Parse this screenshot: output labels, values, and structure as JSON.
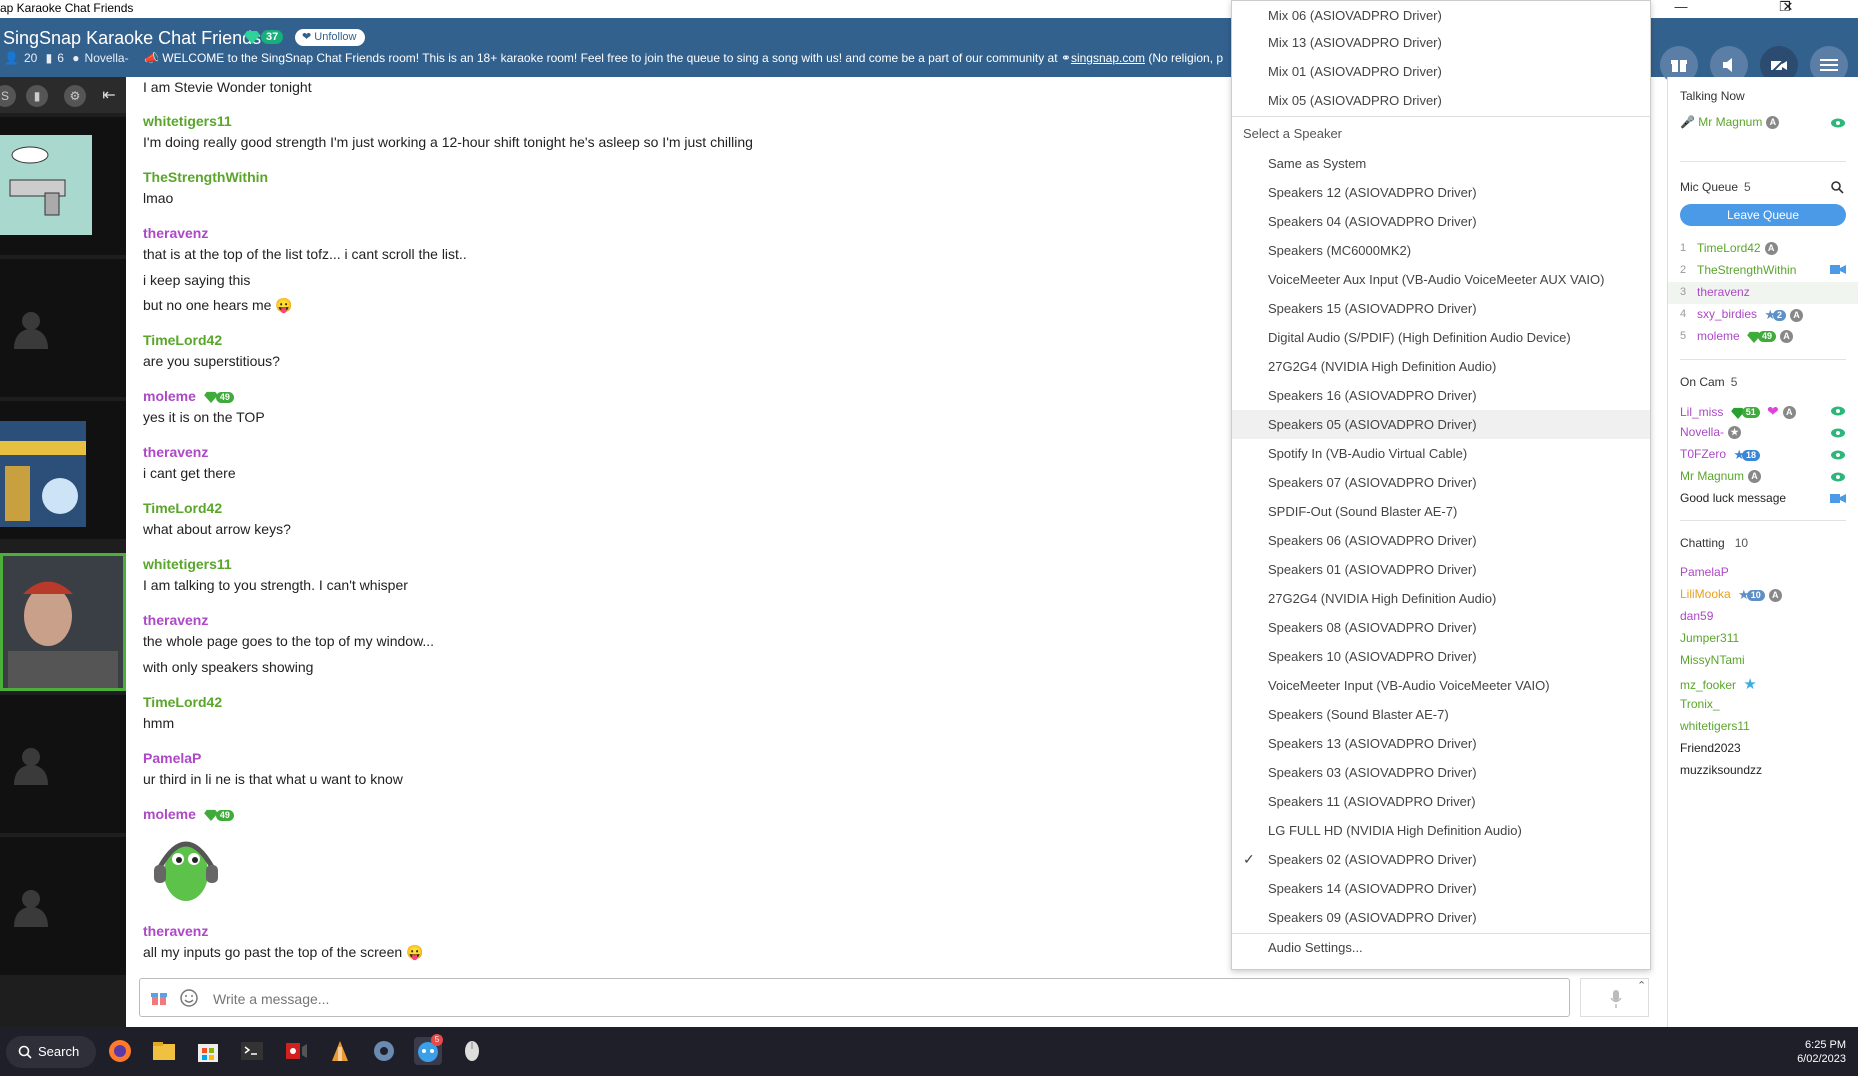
{
  "window": {
    "title": "ap Karaoke Chat Friends"
  },
  "header": {
    "room_title": "SingSnap Karaoke Chat Friends",
    "gem_count": "37",
    "unfollow_label": "Unfollow",
    "stats": {
      "users": "20",
      "cams": "6",
      "host": "Novella-"
    },
    "welcome": "WELCOME to the SingSnap Chat Friends room! This is an 18+ karaoke room! Feel free to join the queue to sing a song with us! and come be a part of our community at",
    "welcome_link": "singsnap.com",
    "welcome_tail": "(No religion, p"
  },
  "chat": {
    "messages": [
      {
        "text": "I am Stevie Wonder tonight"
      },
      {
        "user": "whitetigers11",
        "text": "I'm doing really good strength I'm just working a 12-hour shift tonight he's asleep so I'm just chilling"
      },
      {
        "user": "TheStrengthWithin",
        "text": "lmao"
      },
      {
        "user": "theravenz",
        "lines": [
          "that is at the top of the list tofz... i cant scroll the list..",
          "i keep saying this",
          "but no one hears me 😛"
        ]
      },
      {
        "user": "TimeLord42",
        "text": "are you superstitious?"
      },
      {
        "user": "moleme",
        "gem": "49",
        "text": "yes it is on the TOP"
      },
      {
        "user": "theravenz",
        "text": "i cant get there"
      },
      {
        "user": "TimeLord42",
        "text": "what about arrow keys?"
      },
      {
        "user": "whitetigers11",
        "text": "I am talking to you strength. I can't whisper"
      },
      {
        "user": "theravenz",
        "lines": [
          "the whole page goes to the top of my window...",
          "with only speakers showing"
        ]
      },
      {
        "user": "TimeLord42",
        "text": "hmm"
      },
      {
        "user": "PamelaP",
        "text": "ur third in li ne is that what u want to know"
      },
      {
        "user": "moleme",
        "gem": "49",
        "sticker": "frog-with-headphones"
      },
      {
        "user": "theravenz",
        "text": "all my inputs go past the top of the screen 😛"
      }
    ],
    "composer_placeholder": "Write a message..."
  },
  "speaker_menu": {
    "mic_items": [
      "Mix 06 (ASIOVADPRO Driver)",
      "Mix 13 (ASIOVADPRO Driver)",
      "Mix 01 (ASIOVADPRO Driver)",
      "Mix 05 (ASIOVADPRO Driver)"
    ],
    "header": "Select a Speaker",
    "speaker_items": [
      "Same as System",
      "Speakers 12 (ASIOVADPRO Driver)",
      "Speakers 04 (ASIOVADPRO Driver)",
      "Speakers (MC6000MK2)",
      "VoiceMeeter Aux Input (VB-Audio VoiceMeeter AUX VAIO)",
      "Speakers 15 (ASIOVADPRO Driver)",
      "Digital Audio (S/PDIF) (High Definition Audio Device)",
      "27G2G4 (NVIDIA High Definition Audio)",
      "Speakers 16 (ASIOVADPRO Driver)",
      "Speakers 05 (ASIOVADPRO Driver)",
      "Spotify In (VB-Audio Virtual Cable)",
      "Speakers 07 (ASIOVADPRO Driver)",
      "SPDIF-Out (Sound Blaster AE-7)",
      "Speakers 06 (ASIOVADPRO Driver)",
      "Speakers 01 (ASIOVADPRO Driver)",
      "27G2G4 (NVIDIA High Definition Audio)",
      "Speakers 08 (ASIOVADPRO Driver)",
      "Speakers 10 (ASIOVADPRO Driver)",
      "VoiceMeeter Input (VB-Audio VoiceMeeter VAIO)",
      "Speakers (Sound Blaster AE-7)",
      "Speakers 13 (ASIOVADPRO Driver)",
      "Speakers 03 (ASIOVADPRO Driver)",
      "Speakers 11 (ASIOVADPRO Driver)",
      "LG FULL HD (NVIDIA High Definition Audio)",
      "Speakers 02 (ASIOVADPRO Driver)",
      "Speakers 14 (ASIOVADPRO Driver)",
      "Speakers 09 (ASIOVADPRO Driver)"
    ],
    "hovered": "Speakers 05 (ASIOVADPRO Driver)",
    "selected": "Speakers 02 (ASIOVADPRO Driver)",
    "settings_label": "Audio Settings..."
  },
  "sidebar": {
    "talking_now": {
      "label": "Talking Now",
      "user": "Mr Magnum"
    },
    "mic_queue": {
      "label": "Mic Queue",
      "count": "5",
      "leave_label": "Leave Queue",
      "items": [
        {
          "num": "1",
          "name": "TimeLord42"
        },
        {
          "num": "2",
          "name": "TheStrengthWithin"
        },
        {
          "num": "3",
          "name": "theravenz"
        },
        {
          "num": "4",
          "name": "sxy_birdies",
          "star": "2"
        },
        {
          "num": "5",
          "name": "moleme",
          "gem": "49"
        }
      ]
    },
    "on_cam": {
      "label": "On Cam",
      "count": "5",
      "items": [
        {
          "name": "Lil_miss",
          "gem": "51"
        },
        {
          "name": "Novella-"
        },
        {
          "name": "T0FZero",
          "star": "18"
        },
        {
          "name": "Mr Magnum"
        },
        {
          "name": "Good luck message"
        }
      ]
    },
    "chatting": {
      "label": "Chatting",
      "count": "10",
      "items": [
        {
          "name": "PamelaP"
        },
        {
          "name": "LiliMooka",
          "star": "10"
        },
        {
          "name": "dan59"
        },
        {
          "name": "Jumper311"
        },
        {
          "name": "MissyNTami"
        },
        {
          "name": "mz_fooker"
        },
        {
          "name": "Tronix_"
        },
        {
          "name": "whitetigers11"
        },
        {
          "name": "Friend2023"
        },
        {
          "name": "muzziksoundzz"
        }
      ]
    }
  },
  "taskbar": {
    "search_label": "Search",
    "notification_count": "5",
    "time": "6:25 PM",
    "date": "6/02/2023"
  },
  "colors": {
    "header": "#33618e",
    "green_user": "#5aa62b",
    "purple_user": "#ad48c7",
    "accent_blue": "#4a9ae8"
  }
}
